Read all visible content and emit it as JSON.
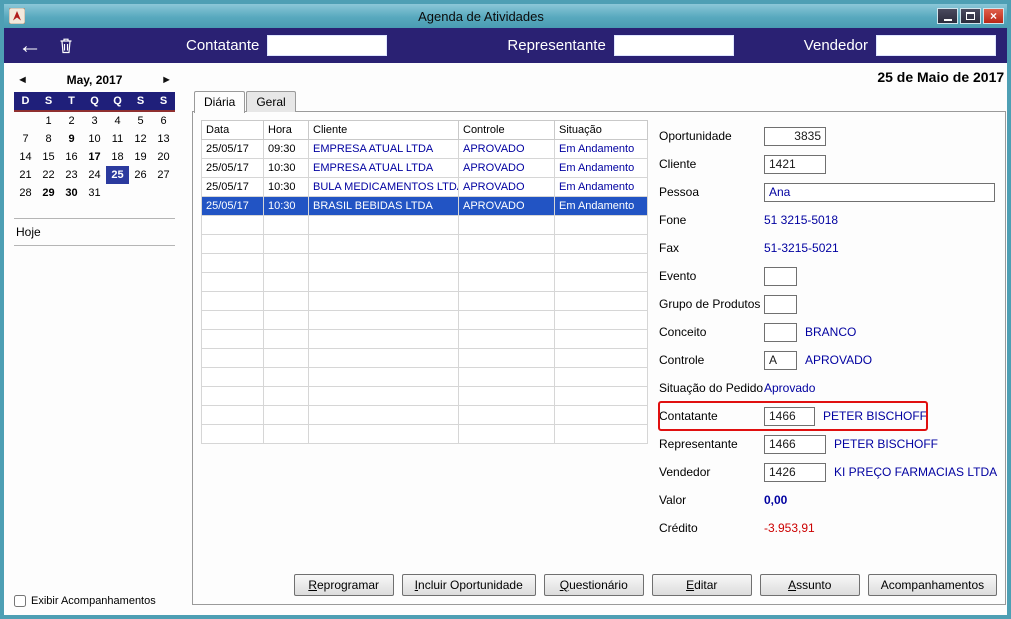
{
  "window": {
    "title": "Agenda de Atividades",
    "controls": [
      "minimize",
      "maximize",
      "close"
    ]
  },
  "colors": {
    "titlebar": "#58a9be",
    "toolbar": "#2a2173",
    "calendar_header": "#1f1f7a",
    "selection_blue": "#2254c4",
    "data_text_blue": "#0000a0",
    "credit_negative": "#cc0000",
    "highlight_border": "#e01010"
  },
  "toolbar": {
    "back_icon": "←",
    "trash_icon": "trash",
    "fields": [
      {
        "label": "Contatante",
        "value": ""
      },
      {
        "label": "Representante",
        "value": ""
      },
      {
        "label": "Vendedor",
        "value": ""
      }
    ]
  },
  "date_heading": "25 de Maio de 2017",
  "calendar": {
    "prev_icon": "◄",
    "next_icon": "►",
    "month_label": "May, 2017",
    "day_headers": [
      "D",
      "S",
      "T",
      "Q",
      "Q",
      "S",
      "S"
    ],
    "weeks": [
      [
        "",
        "1",
        "2",
        "3",
        "4",
        "5",
        "6"
      ],
      [
        "7",
        "8",
        "9",
        "10",
        "11",
        "12",
        "13"
      ],
      [
        "14",
        "15",
        "16",
        "17",
        "18",
        "19",
        "20"
      ],
      [
        "21",
        "22",
        "23",
        "24",
        "25",
        "26",
        "27"
      ],
      [
        "28",
        "29",
        "30",
        "31",
        "",
        "",
        ""
      ]
    ],
    "selected_day": "25",
    "bold_days": [
      "9",
      "17",
      "29",
      "30"
    ],
    "today_label": "Hoje"
  },
  "footer": {
    "checkbox_label": "Exibir Acompanhamentos",
    "checked": false
  },
  "tabs": [
    {
      "label": "Diária",
      "active": true
    },
    {
      "label": "Geral",
      "active": false
    }
  ],
  "table": {
    "columns": [
      "Data",
      "Hora",
      "Cliente",
      "Controle",
      "Situação"
    ],
    "rows": [
      {
        "data": "25/05/17",
        "hora": "09:30",
        "cliente": "EMPRESA ATUAL LTDA",
        "controle": "APROVADO",
        "situacao": "Em Andamento",
        "selected": false
      },
      {
        "data": "25/05/17",
        "hora": "10:30",
        "cliente": "EMPRESA ATUAL LTDA",
        "controle": "APROVADO",
        "situacao": "Em Andamento",
        "selected": false
      },
      {
        "data": "25/05/17",
        "hora": "10:30",
        "cliente": "BULA MEDICAMENTOS LTDA",
        "controle": "APROVADO",
        "situacao": "Em Andamento",
        "selected": false
      },
      {
        "data": "25/05/17",
        "hora": "10:30",
        "cliente": "BRASIL BEBIDAS LTDA",
        "controle": "APROVADO",
        "situacao": "Em Andamento",
        "selected": true
      }
    ]
  },
  "details": {
    "oportunidade": {
      "label": "Oportunidade",
      "value": "3835"
    },
    "cliente": {
      "label": "Cliente",
      "value": "1421"
    },
    "pessoa": {
      "label": "Pessoa",
      "value": "Ana"
    },
    "fone": {
      "label": "Fone",
      "value": "51 3215-5018"
    },
    "fax": {
      "label": "Fax",
      "value": "51-3215-5021"
    },
    "evento": {
      "label": "Evento",
      "value": ""
    },
    "grupo_produtos": {
      "label": "Grupo de Produtos",
      "value": ""
    },
    "conceito": {
      "label": "Conceito",
      "value": "",
      "text": "BRANCO"
    },
    "controle": {
      "label": "Controle",
      "value": "A",
      "text": "APROVADO"
    },
    "situacao_pedido": {
      "label": "Situação do Pedido",
      "text": "Aprovado"
    },
    "contatante": {
      "label": "Contatante",
      "value": "1466",
      "text": "PETER BISCHOFF"
    },
    "representante": {
      "label": "Representante",
      "value": "1466",
      "text": "PETER BISCHOFF"
    },
    "vendedor": {
      "label": "Vendedor",
      "value": "1426",
      "text": "KI PREÇO FARMACIAS LTDA"
    },
    "valor": {
      "label": "Valor",
      "value": "0,00"
    },
    "credito": {
      "label": "Crédito",
      "value": "-3.953,91"
    }
  },
  "action_buttons": [
    {
      "name": "reprogramar-button",
      "label": "Reprogramar",
      "hotkey": true
    },
    {
      "name": "incluir-oportunidade-button",
      "label": "Incluir Oportunidade",
      "hotkey": true
    },
    {
      "name": "questionario-button",
      "label": "Questionário",
      "hotkey": true
    },
    {
      "name": "editar-button",
      "label": "Editar",
      "hotkey": true
    },
    {
      "name": "assunto-button",
      "label": "Assunto",
      "hotkey": true
    },
    {
      "name": "acompanhamentos-button",
      "label": "Acompanhamentos",
      "hotkey": false
    }
  ]
}
